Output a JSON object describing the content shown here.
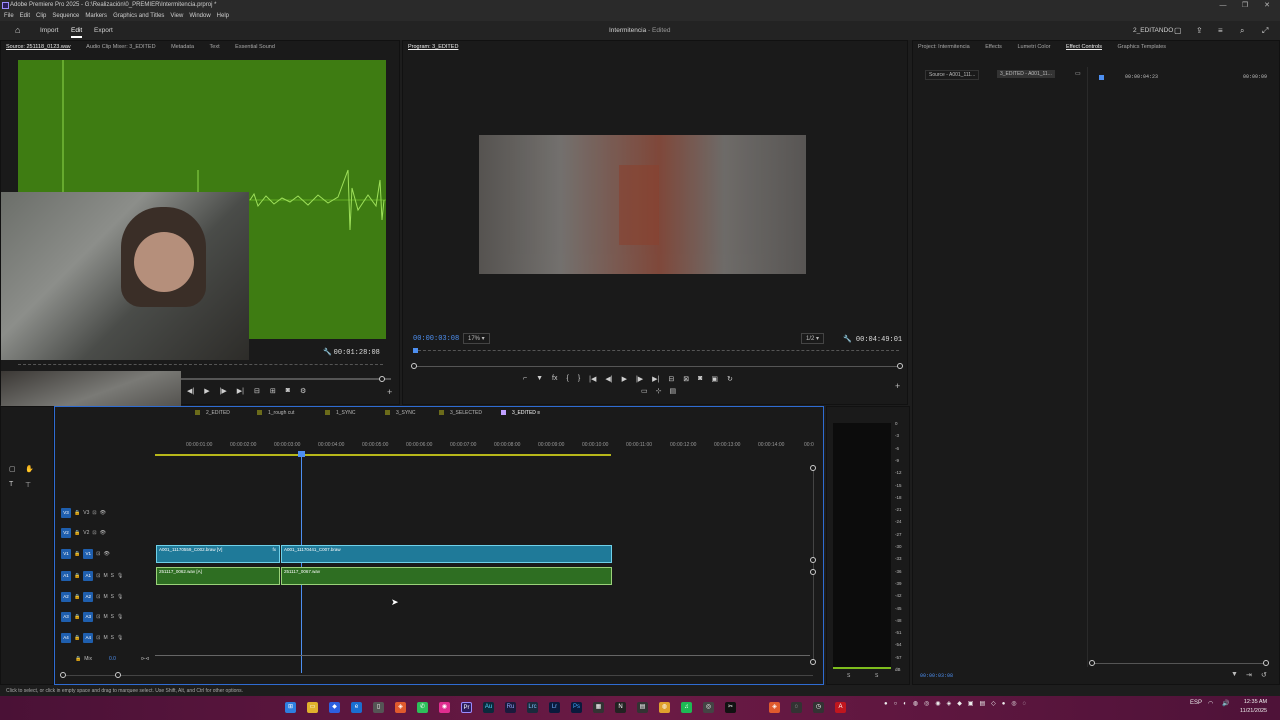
{
  "titlebar": {
    "title": "Adobe Premiere Pro 2025 - G:\\Realización\\0_PREMIER\\Intermitencia.prproj *",
    "min": "—",
    "max": "❐",
    "close": "✕"
  },
  "menus": [
    "File",
    "Edit",
    "Clip",
    "Sequence",
    "Markers",
    "Graphics and Titles",
    "View",
    "Window",
    "Help"
  ],
  "workspace": {
    "home_icon": "home-icon",
    "tabs": [
      "Import",
      "Edit",
      "Export"
    ],
    "active": "Edit",
    "project_title": "Intermitencia",
    "project_status": "- Edited",
    "workspace_label": "2_EDITANDO"
  },
  "source_panel": {
    "tabs": [
      "Source: 251118_0123.wav",
      "Audio Clip Mixer: 3_EDITED",
      "Metadata",
      "Text",
      "Essential Sound"
    ],
    "duration": "00:01:28:08"
  },
  "program_panel": {
    "title": "Program: 3_EDITED",
    "timecode": "00:00:03:08",
    "zoom": "17%",
    "resolution": "1/2",
    "duration": "00:04:49:01"
  },
  "effects_panel": {
    "tabs": [
      "Project: Intermitencia",
      "Effects",
      "Lumetri Color",
      "Effect Controls",
      "Graphics Templates"
    ],
    "source_tab": "Source - A001_111...",
    "seq_tab": "3_EDITED - A001_11...",
    "time_a": "00:00:04:23",
    "time_b": "00:00:09",
    "current_time": "00:00:03:08"
  },
  "sequence_tabs": [
    "2_EDITED",
    "1_rough cut",
    "1_SYNC",
    "3_SYNC",
    "3_SELECTED",
    "3_EDITED"
  ],
  "active_sequence": "3_EDITED",
  "timeline": {
    "ruler": [
      "00:00:01:00",
      "00:00:02:00",
      "00:00:03:00",
      "00:00:04:00",
      "00:00:05:00",
      "00:00:06:00",
      "00:00:07:00",
      "00:00:08:00",
      "00:00:09:00",
      "00:00:10:00",
      "00:00:11:00",
      "00:00:12:00",
      "00:00:13:00",
      "00:00:14:00",
      "00:0"
    ],
    "video_tracks": [
      "V3",
      "V2",
      "V1"
    ],
    "audio_tracks": [
      "A1",
      "A2",
      "A3",
      "A4"
    ],
    "mix_label": "Mix",
    "mix_value": "0.0",
    "clips": {
      "v1_a": "A001_11170559_C002.braw [V]",
      "v1_b": "A001_11170441_C007.braw",
      "a1_a": "251117_0062.wav [A]",
      "a1_b": "251117_0067.wav",
      "fx_badge": "fx"
    }
  },
  "meter_scale": [
    "0",
    "-3",
    "-6",
    "-9",
    "-12",
    "-15",
    "-18",
    "-21",
    "-24",
    "-27",
    "-30",
    "-33",
    "-36",
    "-39",
    "-42",
    "-45",
    "-48",
    "-51",
    "-54",
    "-57",
    "dB"
  ],
  "meter_labels": [
    "S",
    "S"
  ],
  "status": "Click to select, or click in empty space and drag to marquee select. Use Shift, Alt, and Ctrl for other options.",
  "taskbar": {
    "lang": "ESP",
    "time": "12:35 AM",
    "date": "11/21/2025"
  }
}
